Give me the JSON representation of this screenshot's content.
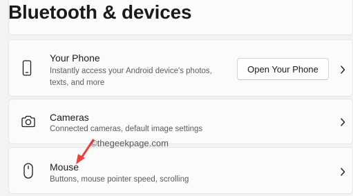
{
  "header": {
    "title": "Bluetooth & devices"
  },
  "items": [
    {
      "title": "Your Phone",
      "desc_line1": "Instantly access your Android device's photos,",
      "desc_line2": "texts, and more",
      "button_label": "Open Your Phone",
      "icon": "phone-icon"
    },
    {
      "title": "Cameras",
      "desc": "Connected cameras, default image settings",
      "icon": "camera-icon"
    },
    {
      "title": "Mouse",
      "desc": "Buttons, mouse pointer speed, scrolling",
      "icon": "mouse-icon"
    }
  ],
  "watermark": "©thegeekpage.com",
  "colors": {
    "background": "#f3f3f3",
    "card": "#fbfbfb",
    "annotation_arrow": "#e8453c"
  }
}
